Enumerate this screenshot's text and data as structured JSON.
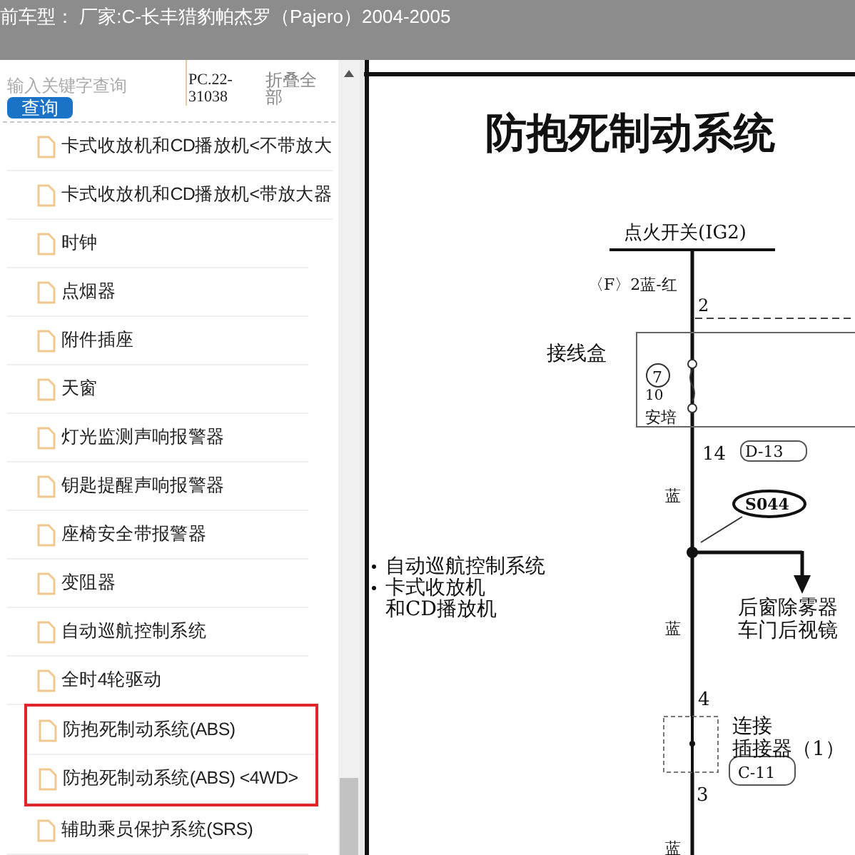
{
  "window": {
    "title": "前车型： 厂家:C-长丰猎豹帕杰罗（Pajero）2004-2005"
  },
  "sidebar": {
    "search": {
      "placeholder": "输入关键字查询"
    },
    "search_button": "查询",
    "code": "PC.22-31038",
    "collapse_all": "折叠全部",
    "items": [
      {
        "label": "卡式收放机和CD播放机<不带放大",
        "highlighted": false
      },
      {
        "label": "卡式收放机和CD播放机<带放大器",
        "highlighted": false
      },
      {
        "label": "时钟",
        "highlighted": false
      },
      {
        "label": "点烟器",
        "highlighted": false
      },
      {
        "label": "附件插座",
        "highlighted": false
      },
      {
        "label": "天窗",
        "highlighted": false
      },
      {
        "label": "灯光监测声响报警器",
        "highlighted": false
      },
      {
        "label": "钥匙提醒声响报警器",
        "highlighted": false
      },
      {
        "label": "座椅安全带报警器",
        "highlighted": false
      },
      {
        "label": "变阻器",
        "highlighted": false
      },
      {
        "label": "自动巡航控制系统",
        "highlighted": false
      },
      {
        "label": "全时4轮驱动",
        "highlighted": false
      },
      {
        "label": "防抱死制动系统(ABS)",
        "highlighted": true
      },
      {
        "label": "防抱死制动系统(ABS) <4WD>",
        "highlighted": true
      },
      {
        "label": "辅助乘员保护系统(SRS)",
        "highlighted": false
      }
    ]
  },
  "document": {
    "title": "防抱死制动系统",
    "labels": [
      "点火开关(IG2)",
      "〈F〉2蓝-红",
      "2",
      "接线盒",
      "7",
      "10",
      "安培",
      "14",
      "D-13",
      "蓝",
      "S044",
      "自动巡航控制系统",
      "卡式收放机",
      "和CD播放机",
      "后窗除雾器",
      "车门后视镜",
      "蓝",
      "4",
      "连接",
      "插接器（1）",
      "C-11",
      "3",
      "蓝"
    ]
  }
}
